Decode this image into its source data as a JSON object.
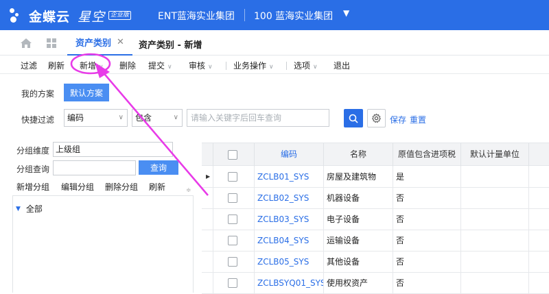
{
  "header": {
    "brand_main": "金蝶云",
    "brand_sub": "星空",
    "brand_badge": "企业版",
    "org": "ENT蓝海实业集团",
    "book": "100  蓝海实业集团"
  },
  "tabs": {
    "active": "资产类别",
    "second": "资产类别 - 新增"
  },
  "toolbar": {
    "filter": "过滤",
    "refresh": "刷新",
    "add": "新增",
    "delete": "删除",
    "submit": "提交",
    "audit": "审核",
    "biz_ops": "业务操作",
    "options": "选项",
    "exit": "退出"
  },
  "filters": {
    "my_scheme_label": "我的方案",
    "default_scheme": "默认方案",
    "quick_filter_label": "快捷过滤",
    "field_value": "编码",
    "operator_value": "包含",
    "search_placeholder": "请输入关键字后回车查询",
    "save": "保存",
    "reset": "重置"
  },
  "group_panel": {
    "dimension_label": "分组维度",
    "dimension_value": "上级组",
    "query_label": "分组查询",
    "query_button": "查询",
    "new_group": "新增分组",
    "edit_group": "编辑分组",
    "delete_group": "删除分组",
    "refresh": "刷新",
    "tree_root": "全部"
  },
  "grid": {
    "columns": [
      "编码",
      "名称",
      "原值包含进项税",
      "默认计量单位"
    ],
    "rows": [
      {
        "code": "ZCLB01_SYS",
        "name": "房屋及建筑物",
        "tax": "是"
      },
      {
        "code": "ZCLB02_SYS",
        "name": "机器设备",
        "tax": "否"
      },
      {
        "code": "ZCLB03_SYS",
        "name": "电子设备",
        "tax": "否"
      },
      {
        "code": "ZCLB04_SYS",
        "name": "运输设备",
        "tax": "否"
      },
      {
        "code": "ZCLB05_SYS",
        "name": "其他设备",
        "tax": "否"
      },
      {
        "code": "ZCLBSYQ01_SYS",
        "name": "使用权资产",
        "tax": "否"
      }
    ]
  },
  "colors": {
    "primary": "#2a6ee6",
    "annotation": "#e83be8"
  }
}
